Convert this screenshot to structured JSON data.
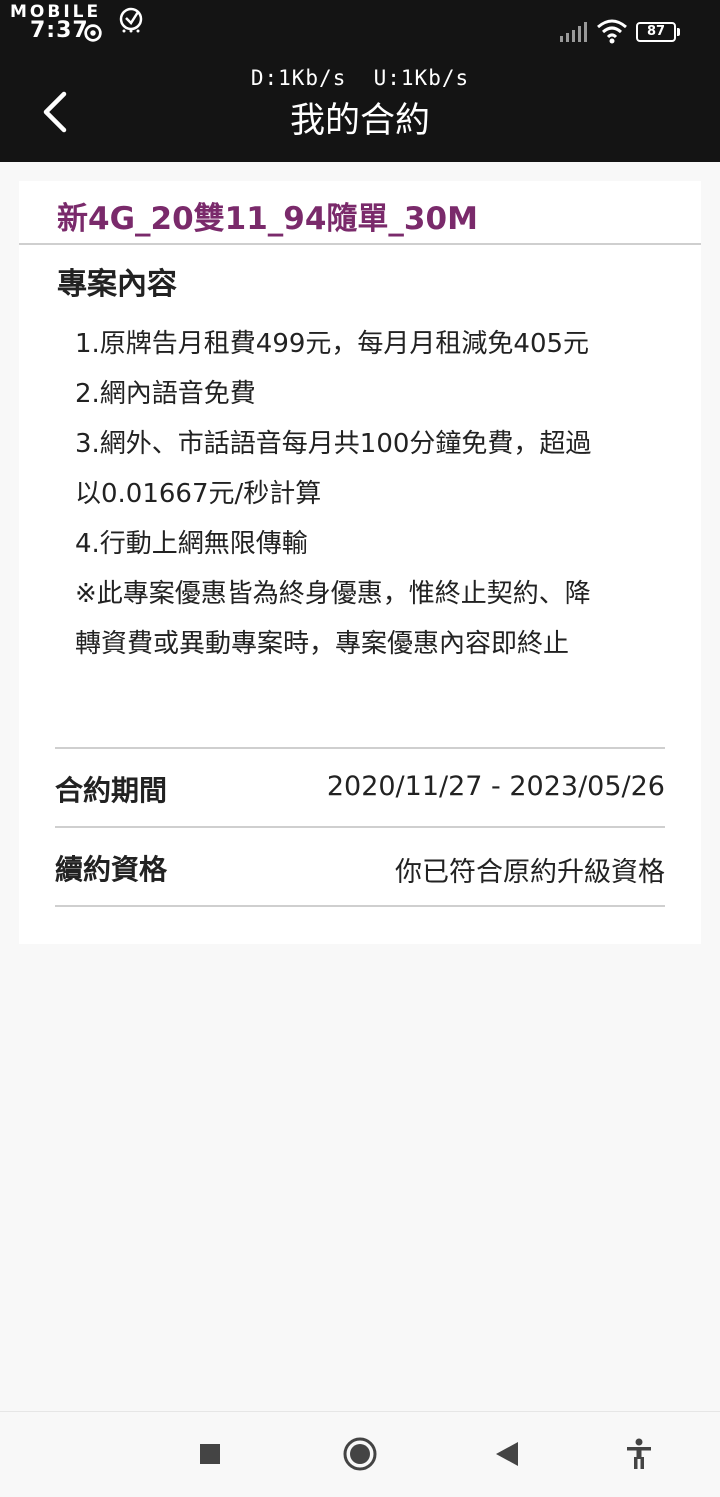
{
  "status_bar": {
    "brand": "MOBILE",
    "time": "7:37",
    "battery": "87"
  },
  "header": {
    "net_speed": "D:1Kb/s  U:1Kb/s",
    "title": "我的合約"
  },
  "plan": {
    "name": "新4G_20雙11_94隨單_30M",
    "section_title": "專案內容",
    "content_lines": [
      "1.原牌告月租費499元，每月月租減免405元",
      "2.網內語音免費",
      "3.網外、市話語音每月共100分鐘免費，超過",
      "以0.01667元/秒計算",
      "4.行動上網無限傳輸",
      "※此專案優惠皆為終身優惠，惟終止契約、降",
      "轉資費或異動專案時，專案優惠內容即終止"
    ]
  },
  "contract_info": [
    {
      "label": "合約期間",
      "value": "2020/11/27 - 2023/05/26"
    },
    {
      "label": "續約資格",
      "value": "你已符合原約升級資格"
    }
  ],
  "colors": {
    "header_bg": "#141414",
    "plan_name": "#7a2a6b",
    "page_bg": "#f8f8f8"
  },
  "icons": {
    "back": "chevron-left-icon",
    "nav_recents": "square-icon",
    "nav_home": "circle-icon",
    "nav_back": "triangle-left-icon",
    "nav_accessibility": "accessibility-icon"
  }
}
